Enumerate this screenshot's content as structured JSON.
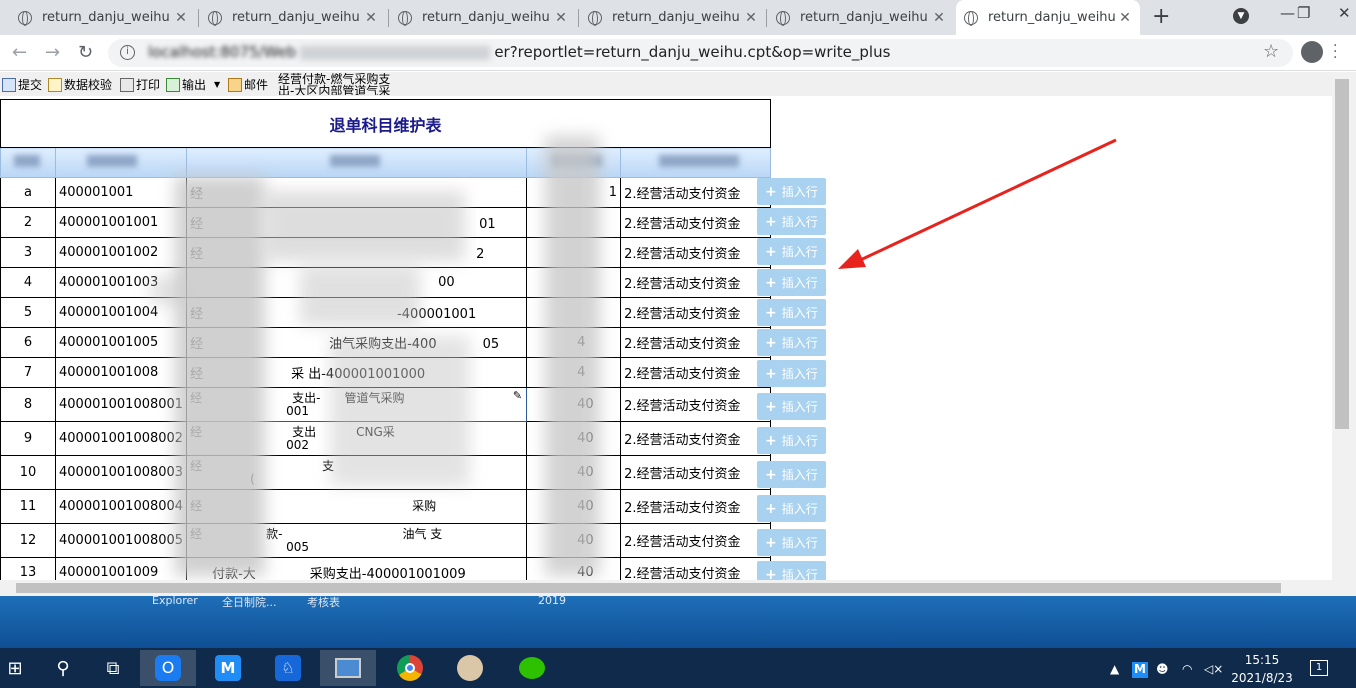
{
  "browser": {
    "tabs": [
      {
        "title": "return_danju_weihu",
        "active": false
      },
      {
        "title": "return_danju_weihu",
        "active": false
      },
      {
        "title": "return_danju_weihu",
        "active": false
      },
      {
        "title": "return_danju_weihu",
        "active": false
      },
      {
        "title": "return_danju_weihu",
        "active": false
      },
      {
        "title": "return_danju_weihu",
        "active": true
      }
    ],
    "url_prefix": "localhost:8075/Web",
    "url_suffix": "er?reportlet=return_danju_weihu.cpt&op=write_plus",
    "tab_close": "✕",
    "new_tab": "+"
  },
  "toolbar": {
    "submit": "提交",
    "validate": "数据校验",
    "print": "打印",
    "export": "输出",
    "email": "邮件",
    "extra_line1": "经营付款-燃气采购支",
    "extra_line2": "出-大区内部管道气采"
  },
  "report": {
    "title": "退单科目维护表",
    "insert_label": "插入行",
    "rows": [
      {
        "no": "a",
        "code": "400001001",
        "name": "经",
        "v4": "1",
        "type": "2.经营活动支付资金"
      },
      {
        "no": "2",
        "code": "400001001001",
        "name": "经",
        "v4": "",
        "type": "2.经营活动支付资金"
      },
      {
        "no": "3",
        "code": "400001001002",
        "name": "经",
        "v4": "",
        "type": "2.经营活动支付资金"
      },
      {
        "no": "4",
        "code": "400001001003",
        "name": "",
        "v4": "",
        "type": "2.经营活动支付资金"
      },
      {
        "no": "5",
        "code": "400001001004",
        "name": "经",
        "v4": "",
        "type": "2.经营活动支付资金"
      },
      {
        "no": "6",
        "code": "400001001005",
        "name": "经",
        "v4": "4",
        "type": "2.经营活动支付资金"
      },
      {
        "no": "7",
        "code": "400001001008",
        "name": "经",
        "v4": "4",
        "type": "2.经营活动支付资金"
      },
      {
        "no": "8",
        "code": "400001001008001",
        "name": "经",
        "v4": "40",
        "type": "2.经营活动支付资金"
      },
      {
        "no": "9",
        "code": "400001001008002",
        "name": "经",
        "v4": "40",
        "type": "2.经营活动支付资金"
      },
      {
        "no": "10",
        "code": "400001001008003",
        "name": "经",
        "v4": "40",
        "type": "2.经营活动支付资金"
      },
      {
        "no": "11",
        "code": "400001001008004",
        "name": "经",
        "v4": "40",
        "type": "2.经营活动支付资金"
      },
      {
        "no": "12",
        "code": "400001001008005",
        "name": "经",
        "v4": "40",
        "type": "2.经营活动支付资金"
      },
      {
        "no": "13",
        "code": "400001001009",
        "name": "付款-大",
        "v4": "40",
        "type": "2.经营活动支付资金"
      }
    ],
    "fragments": {
      "r2": "01",
      "r3": "2",
      "r4": "00",
      "r5": "-400001001",
      "r6": "油气采购支出-400",
      "r6b": "05",
      "r7": "采    出-400001001000",
      "r8a": "支出-",
      "r8b": "管道气采购",
      "r8c": "001",
      "r9a": "支出",
      "r9b": "CNG采",
      "r9c": "002",
      "r10a": "支",
      "r10c": "(",
      "r11b": "采购",
      "r12a": "款-",
      "r12b": "油气   支",
      "r12c": "005",
      "r13": "采购支出-400001001009"
    }
  },
  "desktop": {
    "labels": [
      "Explorer",
      "全日制院...",
      "考核表",
      "2019"
    ]
  },
  "taskbar": {
    "time": "15:15",
    "date": "2021/8/23",
    "notification_count": "1"
  }
}
